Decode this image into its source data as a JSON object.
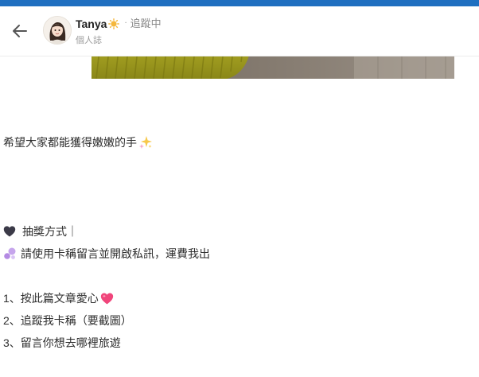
{
  "header": {
    "username": "Tanya",
    "separator": "·",
    "follow_status": "追蹤中",
    "subtitle": "個人誌"
  },
  "post": {
    "line1": "希望大家都能獲得嫩嫩的手",
    "section_title": "抽獎方式｜",
    "instruction": "請使用卡稱留言並開啟私訊，運費我出",
    "steps": [
      "1、按此篇文章愛心",
      "2、追蹤我卡稱（要截圖）",
      "3、留言你想去哪裡旅遊"
    ]
  },
  "icons": {
    "back": "arrow-left-icon",
    "badge": "sun-badge-icon",
    "sparkles": "sparkles-icon",
    "black_heart": "black-heart-icon",
    "bubbles": "purple-bubbles-icon",
    "heart": "pink-heart-icon"
  },
  "colors": {
    "topbar": "#1f6fc0",
    "text": "#2e2e2e",
    "muted": "#8a8a8a"
  }
}
